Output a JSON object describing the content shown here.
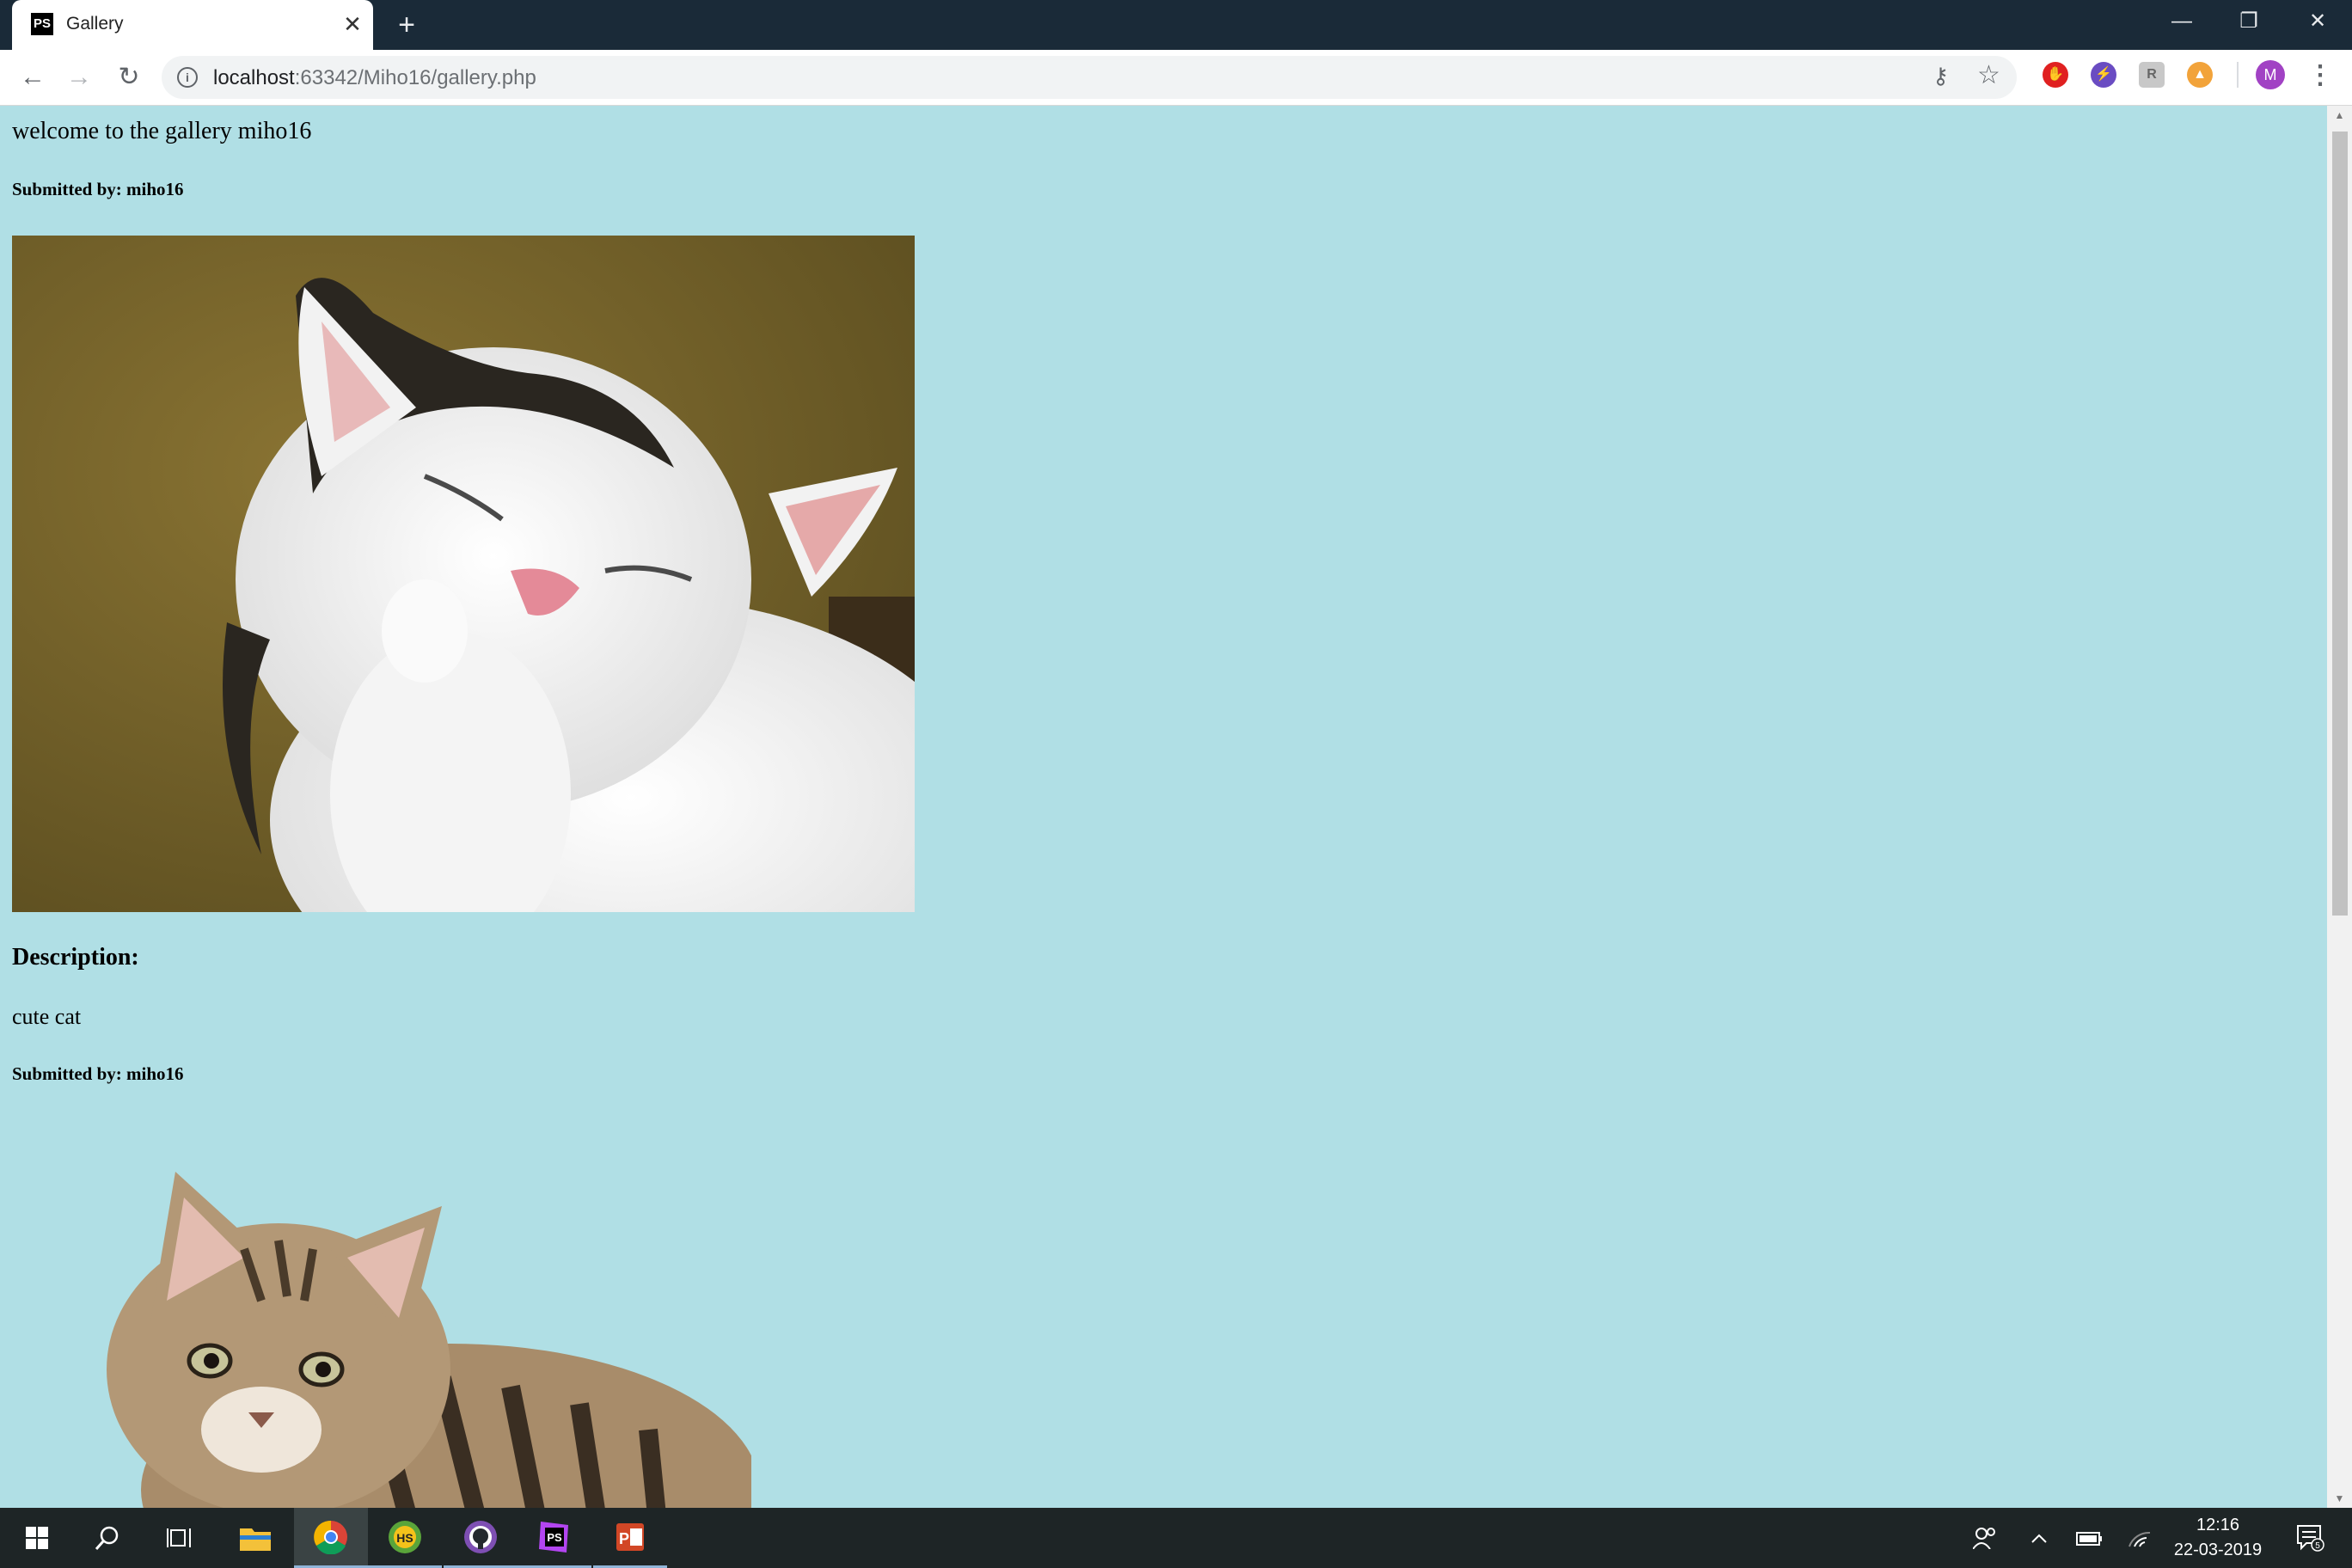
{
  "browser": {
    "tab": {
      "favicon_text": "PS",
      "title": "Gallery",
      "close": "✕"
    },
    "new_tab": "+",
    "window_controls": {
      "minimize": "—",
      "maximize": "❐",
      "close": "✕"
    },
    "url": {
      "host": "localhost",
      "rest": ":63342/Miho16/gallery.php"
    },
    "avatar_letter": "M"
  },
  "page": {
    "welcome": "welcome to the gallery miho16",
    "posts": [
      {
        "submitted_by": "Submitted by: miho16",
        "image": "white cat smiling with paw on face",
        "description_label": "Description:",
        "description": "cute cat"
      },
      {
        "submitted_by": "Submitted by: miho16",
        "image": "tabby kitten lying down"
      }
    ],
    "background_color": "#b0dfe5"
  },
  "taskbar": {
    "apps": [
      "windows-start",
      "search",
      "task-view",
      "file-explorer",
      "chrome",
      "hs-app",
      "github-desktop",
      "phpstorm",
      "powerpoint"
    ],
    "clock": {
      "time": "12:16",
      "date": "22-03-2019"
    },
    "notifications": "5"
  }
}
